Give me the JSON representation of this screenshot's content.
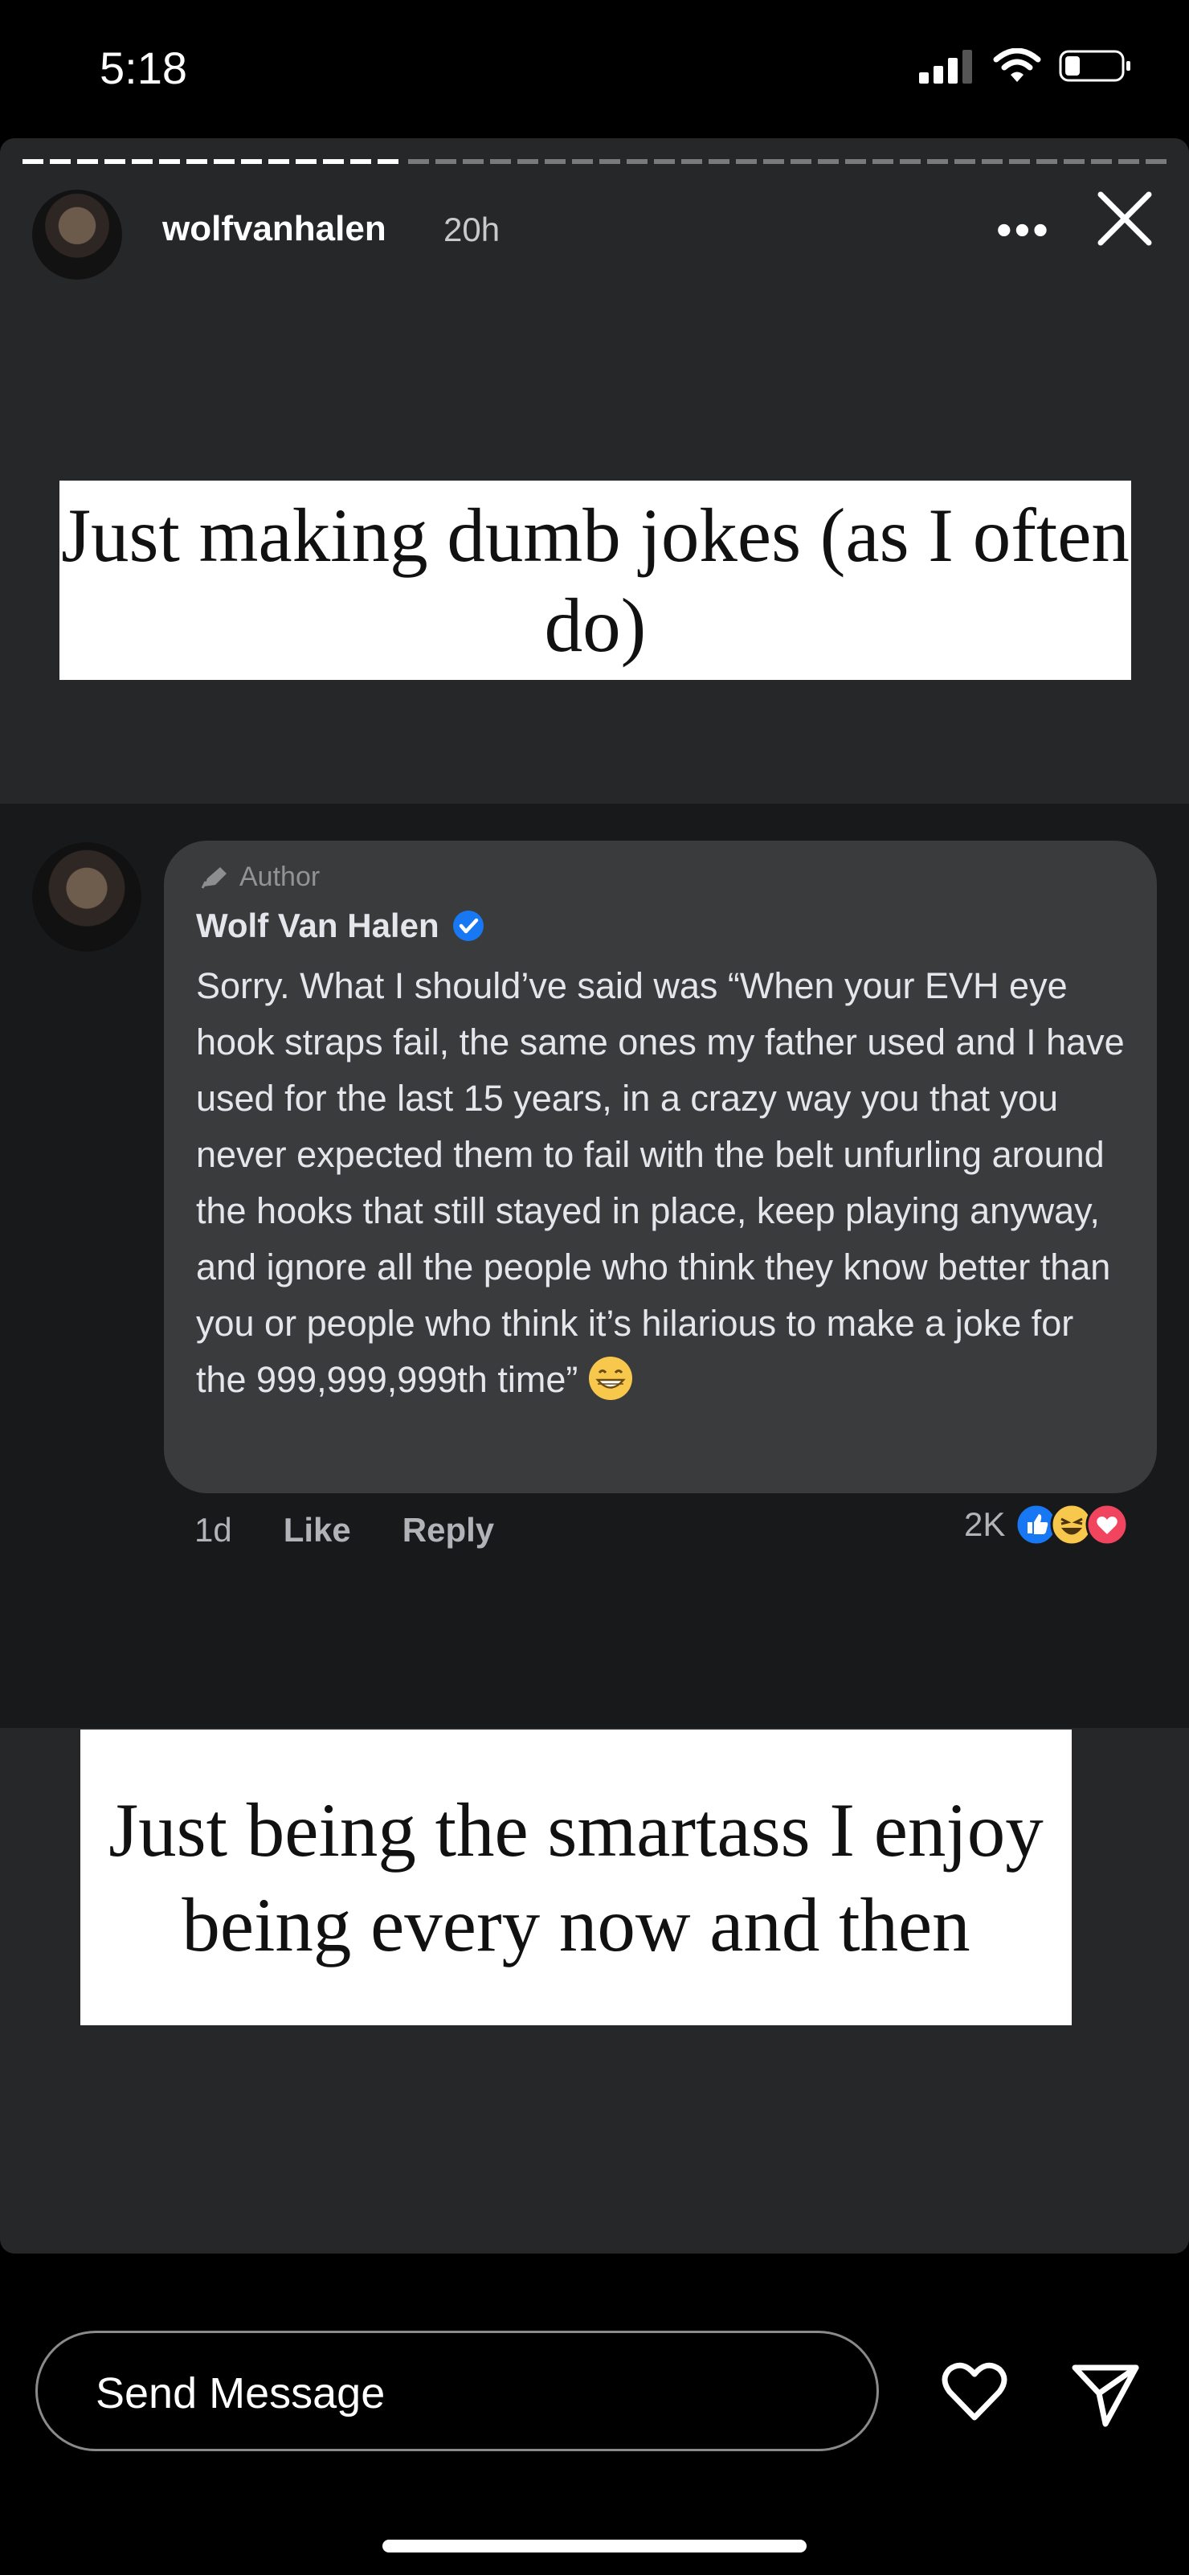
{
  "status_bar": {
    "time": "5:18"
  },
  "story": {
    "username": "wolfvanhalen",
    "posted": "20h",
    "progress_segments": 2,
    "progress_active_index": 0,
    "caption_top": "Just making dumb jokes (as I often do)",
    "caption_bottom": "Just being the smartass I enjoy being every now and then"
  },
  "comment": {
    "author_tag": "Author",
    "author_name": "Wolf Van Halen",
    "text": "Sorry. What I should’ve said was “When your EVH eye hook straps fail, the same ones my father used and I have used for the last 15 years, in a crazy way you that you never expected them to fail with the belt unfurling around the hooks that still stayed in place, keep playing anyway, and ignore all the people who think they know better than you or people who think it’s hilarious to make a joke for the 999,999,999th time”",
    "age": "1d",
    "like_label": "Like",
    "reply_label": "Reply",
    "reaction_count": "2K",
    "reaction_icons": [
      "like-icon",
      "haha-icon",
      "love-icon"
    ]
  },
  "send_bar": {
    "placeholder": "Send Message"
  },
  "colors": {
    "story_bg": "#262729",
    "comment_bg": "#18191a",
    "bubble_bg": "#3a3b3c",
    "verified": "#1877f2"
  }
}
